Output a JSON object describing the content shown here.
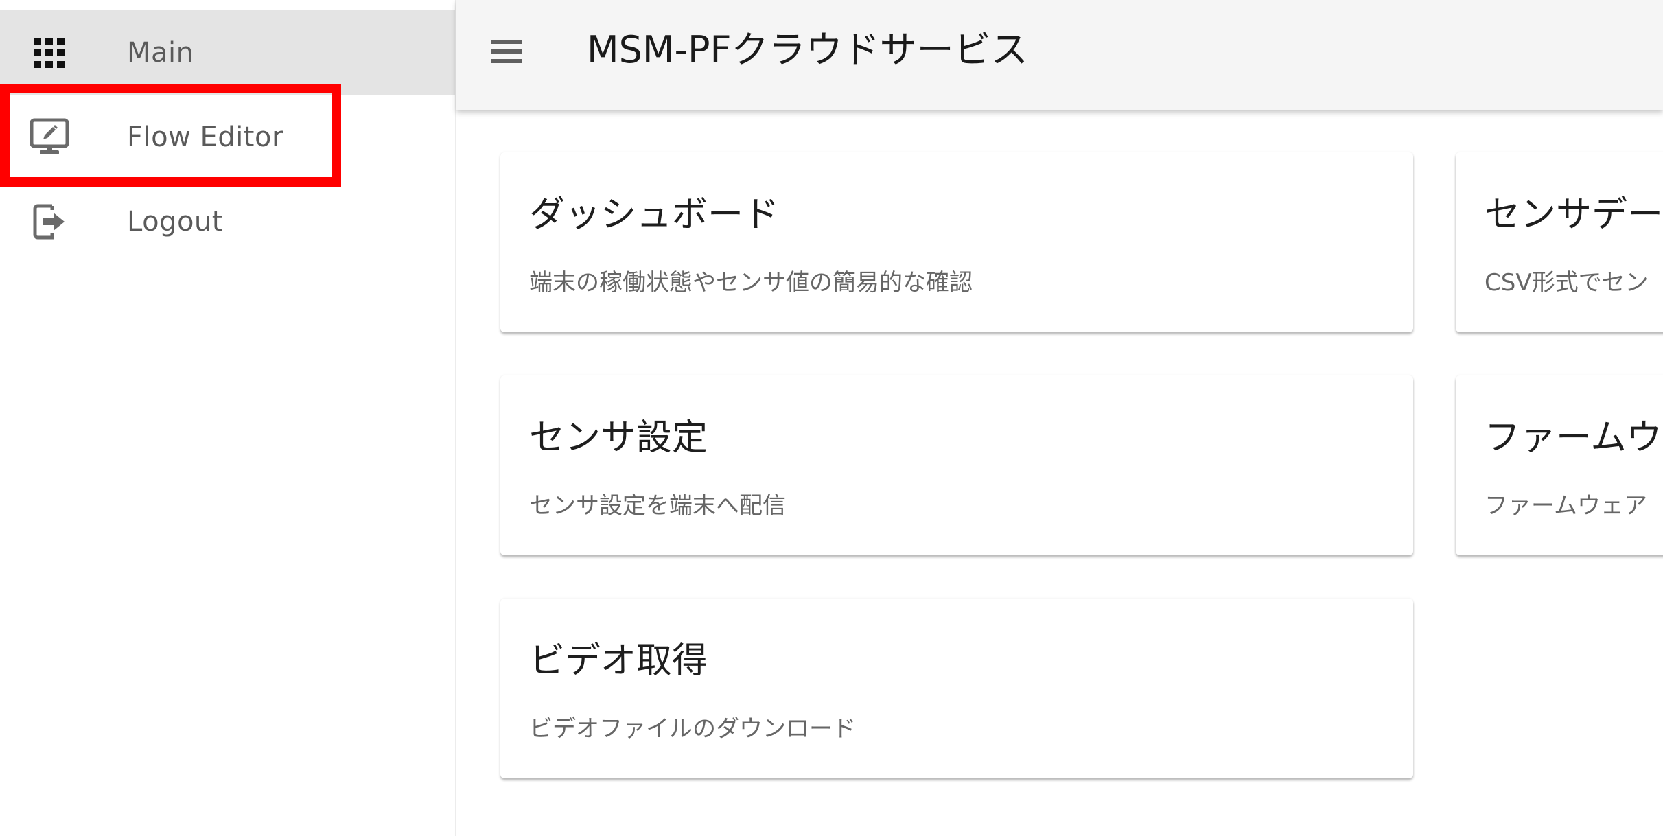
{
  "sidebar": {
    "items": [
      {
        "label": "Main",
        "icon": "apps-grid-icon",
        "active": true
      },
      {
        "label": "Flow Editor",
        "icon": "monitor-edit-icon",
        "active": false
      },
      {
        "label": "Logout",
        "icon": "logout-icon",
        "active": false
      }
    ]
  },
  "appbar": {
    "menu_icon": "hamburger-menu-icon",
    "title": "MSM-PFクラウドサービス"
  },
  "cards": [
    {
      "title": "ダッシュボード",
      "description": "端末の稼働状態やセンサ値の簡易的な確認"
    },
    {
      "title": "センサデー",
      "description": "CSV形式でセン"
    },
    {
      "title": "センサ設定",
      "description": "センサ設定を端末へ配信"
    },
    {
      "title": "ファームウ",
      "description": "ファームウェア"
    },
    {
      "title": "ビデオ取得",
      "description": "ビデオファイルのダウンロード"
    }
  ],
  "annotation": {
    "highlight_target": "Flow Editor",
    "highlight_color": "#ff0000"
  },
  "colors": {
    "appbar_bg": "#f5f5f5",
    "active_nav_bg": "#e4e4e4",
    "highlight": "#ff0000"
  }
}
